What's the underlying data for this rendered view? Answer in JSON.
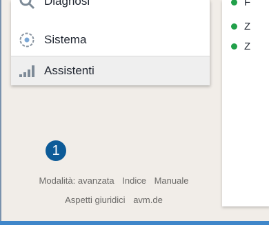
{
  "menu": {
    "items": [
      {
        "label": "Diagnosi",
        "icon": "magnifier-icon"
      },
      {
        "label": "Sistema",
        "icon": "target-icon"
      },
      {
        "label": "Assistenti",
        "icon": "bars-icon"
      }
    ]
  },
  "status": {
    "items": [
      {
        "text": "F"
      },
      {
        "text": "Z"
      },
      {
        "text": "Z"
      }
    ]
  },
  "footer": {
    "badge": "1",
    "links_row1": [
      "Modalità: avanzata",
      "Indice",
      "Manuale"
    ],
    "links_row2": [
      "Aspetti giuridici",
      "avm.de"
    ]
  }
}
